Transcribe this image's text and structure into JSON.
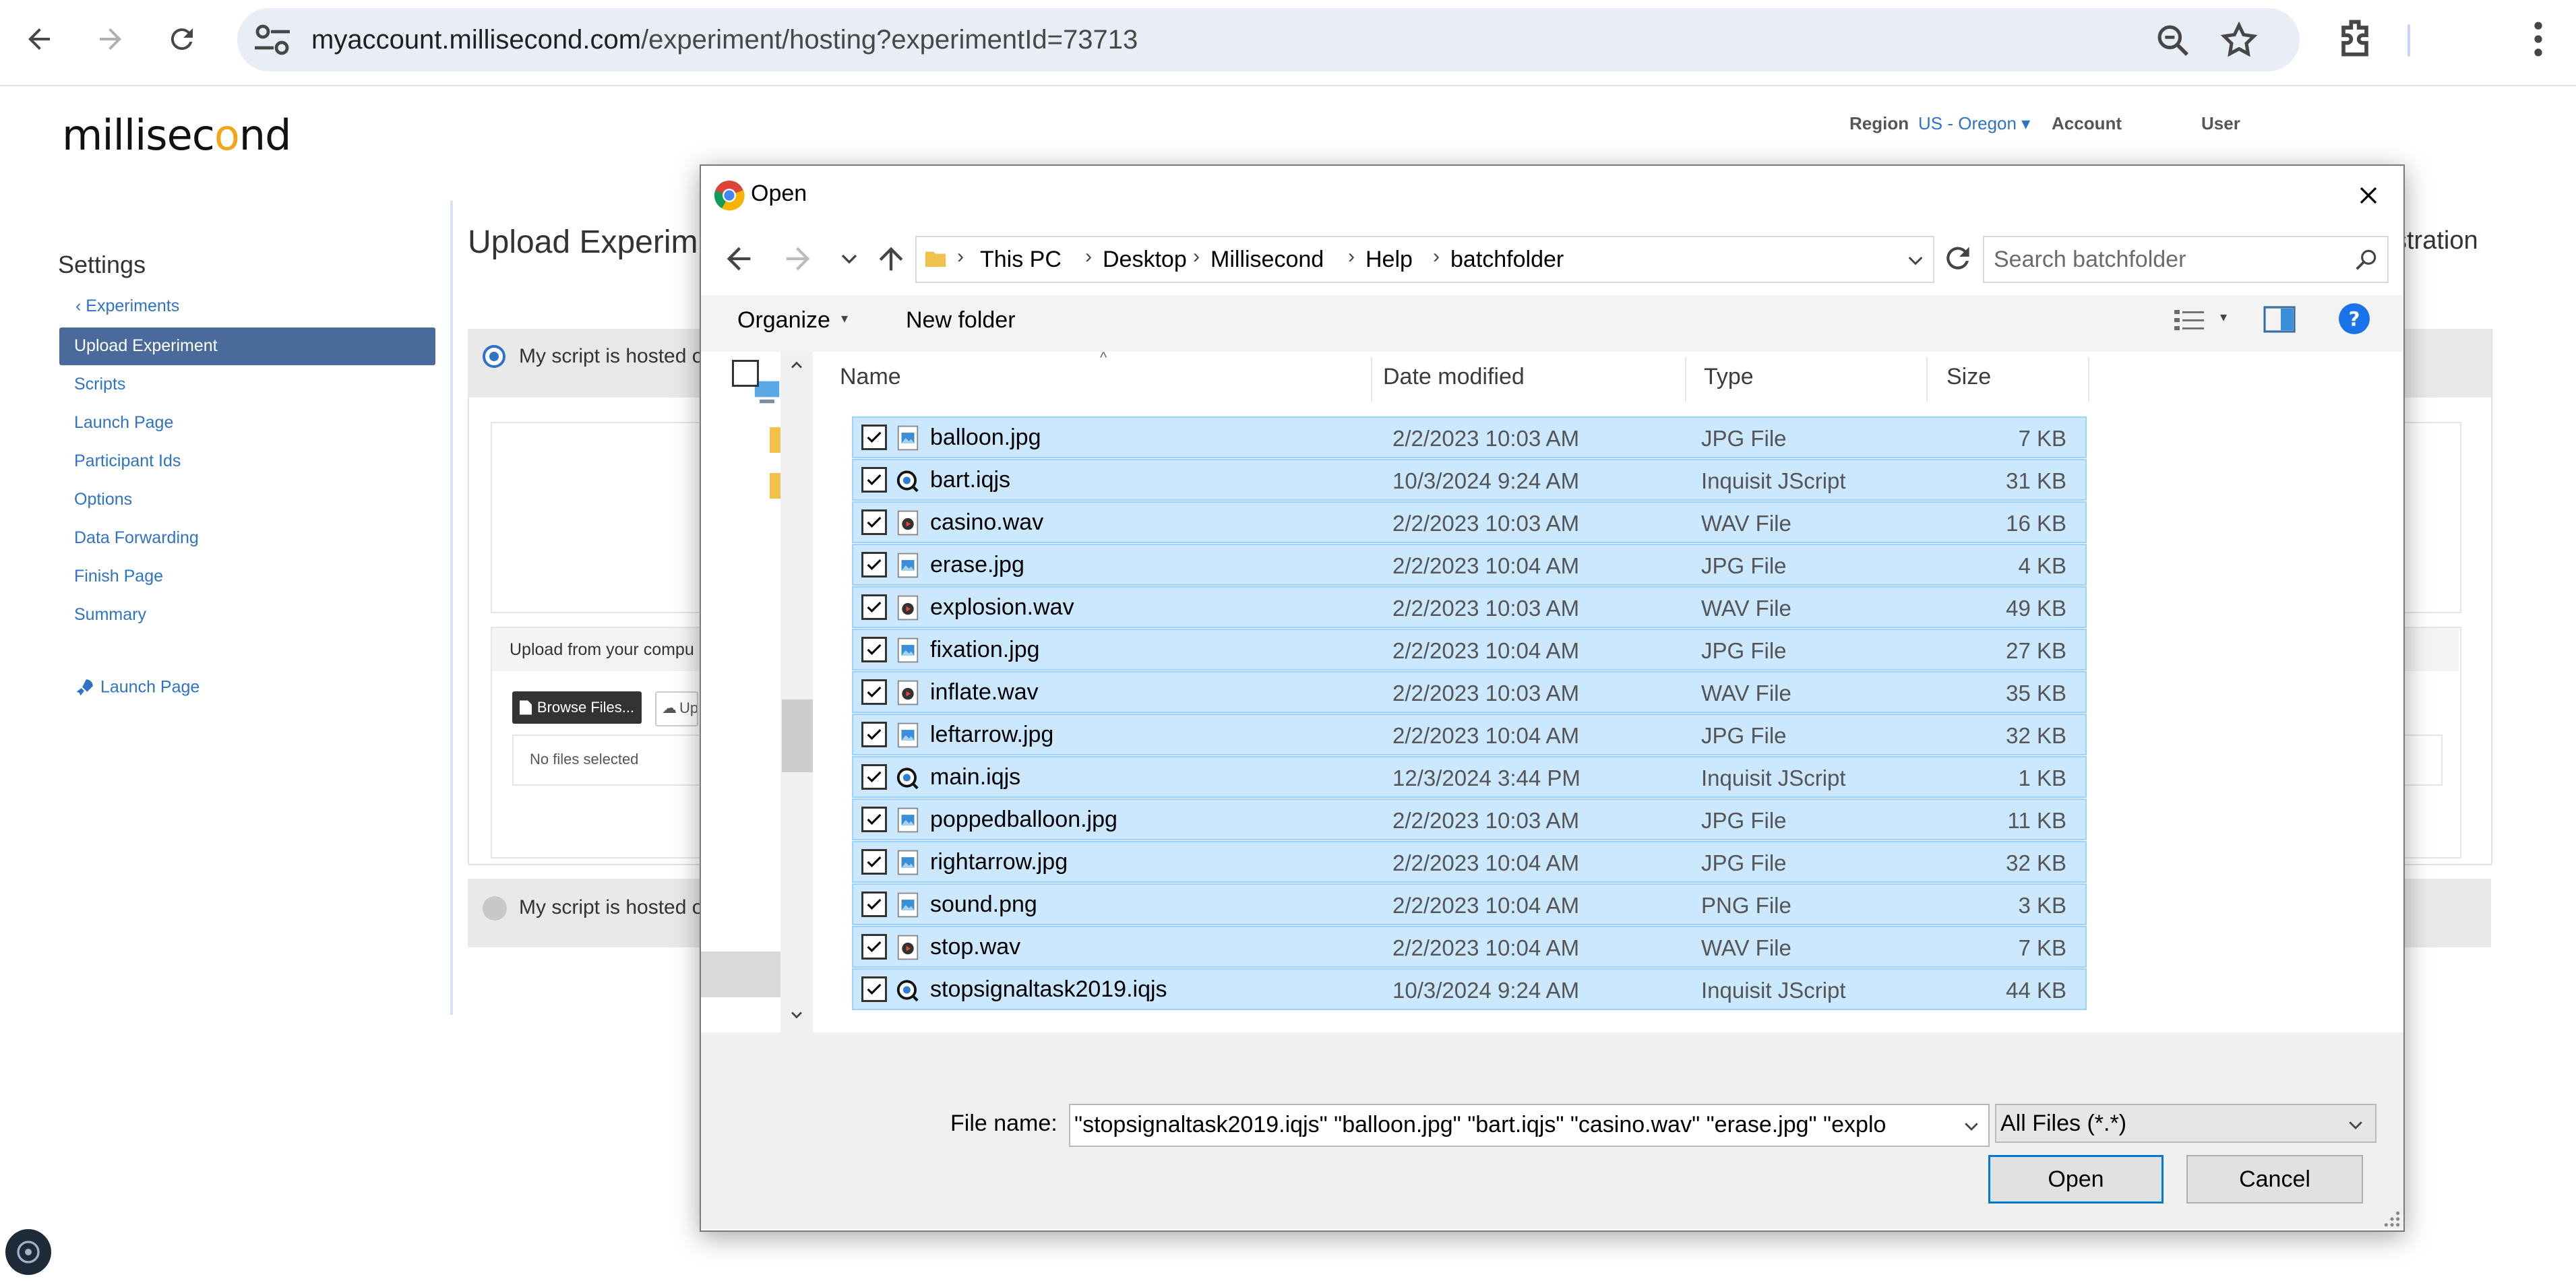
{
  "browser": {
    "url_host": "myaccount.millisecond.com",
    "url_path": "/experiment/hosting?experimentId=73713"
  },
  "site": {
    "logo": "millisecond",
    "header": {
      "region_label": "Region",
      "region_value": "US - Oregon",
      "account_label": "Account",
      "user_label": "User"
    },
    "sidebar": {
      "title": "Settings",
      "back_link": "Experiments",
      "items": [
        "Upload Experiment",
        "Scripts",
        "Launch Page",
        "Participant Ids",
        "Options",
        "Data Forwarding",
        "Finish Page",
        "Summary"
      ],
      "launch_link": "Launch Page"
    },
    "main": {
      "title": "Upload Experim",
      "title_suffix": "stration",
      "option1_label": "My script is hosted o",
      "upload_label": "Upload from your compu",
      "browse_label": "Browse Files...",
      "upload_button_label": "Up",
      "no_files": "No files selected",
      "option2_label": "My script is hosted o"
    }
  },
  "dialog": {
    "title": "Open",
    "breadcrumb": [
      "This PC",
      "Desktop",
      "Millisecond",
      "Help",
      "batchfolder"
    ],
    "search_placeholder": "Search batchfolder",
    "organize_label": "Organize",
    "new_folder_label": "New folder",
    "columns": {
      "name": "Name",
      "date": "Date modified",
      "type": "Type",
      "size": "Size"
    },
    "files": [
      {
        "name": "balloon.jpg",
        "date": "2/2/2023 10:03 AM",
        "type": "JPG File",
        "size": "7 KB",
        "icon": "image-file-icon"
      },
      {
        "name": "bart.iqjs",
        "date": "10/3/2024 9:24 AM",
        "type": "Inquisit JScript",
        "size": "31 KB",
        "icon": "inquisit-file-icon"
      },
      {
        "name": "casino.wav",
        "date": "2/2/2023 10:03 AM",
        "type": "WAV File",
        "size": "16 KB",
        "icon": "audio-file-icon"
      },
      {
        "name": "erase.jpg",
        "date": "2/2/2023 10:04 AM",
        "type": "JPG File",
        "size": "4 KB",
        "icon": "image-file-icon"
      },
      {
        "name": "explosion.wav",
        "date": "2/2/2023 10:03 AM",
        "type": "WAV File",
        "size": "49 KB",
        "icon": "audio-file-icon"
      },
      {
        "name": "fixation.jpg",
        "date": "2/2/2023 10:04 AM",
        "type": "JPG File",
        "size": "27 KB",
        "icon": "image-file-icon"
      },
      {
        "name": "inflate.wav",
        "date": "2/2/2023 10:03 AM",
        "type": "WAV File",
        "size": "35 KB",
        "icon": "audio-file-icon"
      },
      {
        "name": "leftarrow.jpg",
        "date": "2/2/2023 10:04 AM",
        "type": "JPG File",
        "size": "32 KB",
        "icon": "image-file-icon"
      },
      {
        "name": "main.iqjs",
        "date": "12/3/2024 3:44 PM",
        "type": "Inquisit JScript",
        "size": "1 KB",
        "icon": "inquisit-file-icon"
      },
      {
        "name": "poppedballoon.jpg",
        "date": "2/2/2023 10:03 AM",
        "type": "JPG File",
        "size": "11 KB",
        "icon": "image-file-icon"
      },
      {
        "name": "rightarrow.jpg",
        "date": "2/2/2023 10:04 AM",
        "type": "JPG File",
        "size": "32 KB",
        "icon": "image-file-icon"
      },
      {
        "name": "sound.png",
        "date": "2/2/2023 10:04 AM",
        "type": "PNG File",
        "size": "3 KB",
        "icon": "image-file-icon"
      },
      {
        "name": "stop.wav",
        "date": "2/2/2023 10:04 AM",
        "type": "WAV File",
        "size": "7 KB",
        "icon": "audio-file-icon"
      },
      {
        "name": "stopsignaltask2019.iqjs",
        "date": "10/3/2024 9:24 AM",
        "type": "Inquisit JScript",
        "size": "44 KB",
        "icon": "inquisit-file-icon"
      }
    ],
    "file_name_label": "File name:",
    "file_name_value": "\"stopsignaltask2019.iqjs\" \"balloon.jpg\" \"bart.iqjs\" \"casino.wav\" \"erase.jpg\" \"explo",
    "filter_value": "All Files (*.*)",
    "open_label": "Open",
    "cancel_label": "Cancel"
  },
  "colors": {
    "selection": "#cce8ff",
    "accent": "#0078d4",
    "site_link": "#2f73c6",
    "sidebar_active": "#4a6a9b"
  }
}
